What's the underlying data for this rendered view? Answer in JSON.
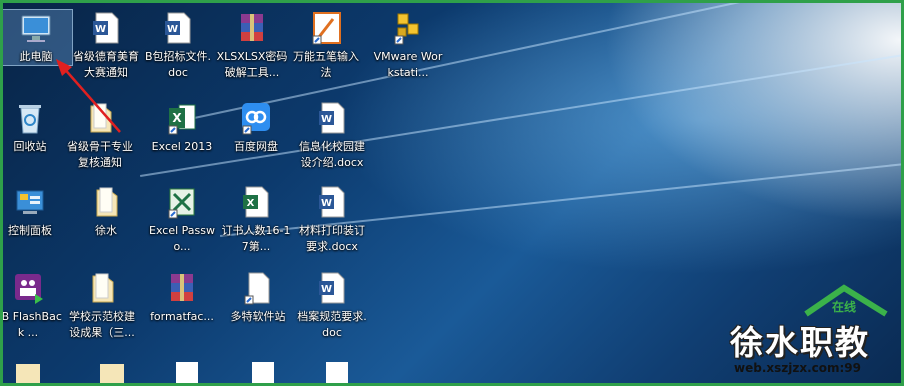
{
  "desktop_icons": [
    {
      "label": "此电脑",
      "icon": "computer-icon"
    },
    {
      "label": "省级德育美育大赛通知",
      "icon": "word-doc-icon"
    },
    {
      "label": "B包招标文件.doc",
      "icon": "word-doc-icon"
    },
    {
      "label": "XLSXLSX密码破解工具...",
      "icon": "winrar-icon"
    },
    {
      "label": "万能五笔输入法",
      "icon": "wubi-input-icon"
    },
    {
      "label": "VMware Workstati...",
      "icon": "vmware-icon"
    },
    {
      "label": "回收站",
      "icon": "recycle-bin-icon"
    },
    {
      "label": "省级骨干专业复核通知",
      "icon": "folder-icon"
    },
    {
      "label": "Excel 2013",
      "icon": "excel-icon"
    },
    {
      "label": "百度网盘",
      "icon": "baidu-netdisk-icon"
    },
    {
      "label": "信息化校园建设介绍.docx",
      "icon": "word-doc-icon"
    },
    {
      "label": "控制面板",
      "icon": "control-panel-icon"
    },
    {
      "label": "徐水",
      "icon": "folder-icon"
    },
    {
      "label": "Excel Passwo...",
      "icon": "excel-password-icon"
    },
    {
      "label": "订书人数16-17第...",
      "icon": "excel-file-icon"
    },
    {
      "label": "材料打印装订要求.docx",
      "icon": "word-doc-icon"
    },
    {
      "label": "BB FlashBack ...",
      "icon": "flashback-icon"
    },
    {
      "label": "学校示范校建设成果（三...",
      "icon": "folder-icon"
    },
    {
      "label": "formatfac...",
      "icon": "winrar-icon"
    },
    {
      "label": "多特软件站",
      "icon": "blank-file-icon"
    },
    {
      "label": "档案规范要求.doc",
      "icon": "word-doc-icon"
    }
  ],
  "watermark": {
    "small_text": "在线",
    "title": "徐水职教",
    "url": "web.xszjzx.com:99"
  },
  "colors": {
    "frame": "#2fa04a",
    "arrow": "#e02020",
    "selection": "#9fc6ec"
  }
}
